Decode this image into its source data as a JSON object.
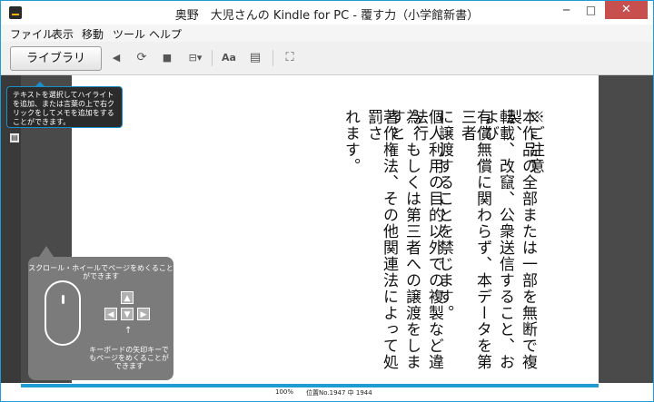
{
  "window": {
    "title": "奥野　大児さんの Kindle for PC - 覆す力（小学館新書）",
    "controls": {
      "minimize": "─",
      "maximize": "□",
      "close": "✕"
    }
  },
  "menu": [
    "ファイル",
    "表示",
    "移動",
    "ツール",
    "ヘルプ"
  ],
  "toolbar": {
    "library_label": "ライブラリ",
    "icons": [
      "back-arrow-icon",
      "sync-icon",
      "bookmark-icon",
      "goto-icon",
      "font-size-icon",
      "view-mode-icon",
      "fullscreen-icon"
    ],
    "glyphs": {
      "back": "◀",
      "sync": "⟳",
      "bookmark": "■",
      "goto": "⊟▾",
      "font": "Aa",
      "view": "▤",
      "fullscreen": "⛶"
    }
  },
  "page_text": {
    "columns": [
      "※ご注意",
      "本作品の全部または一部を無断で複製、",
      "転載、改竄、公衆送信すること、および",
      "有償無償に関わらず、本データを第三者",
      "に譲渡することを禁じます。",
      "個人利用の目的以外での複製など違法行",
      "為、もしくは第三者への譲渡をしますと",
      "著作権法、その他関連法によって処罰さ",
      "れます。"
    ]
  },
  "tooltips": {
    "highlight_tip": "テキストを選択してハイライトを追加、または言葉の上で右クリックをしてメモを追加をすることができます。",
    "scroll_tip": "スクロール・ホイールでページをめくることができます",
    "keyboard_tip": "キーボードの矢印キーでもページをめくることができます",
    "arrow_keys": {
      "up": "▲",
      "left": "◀",
      "down": "▼",
      "right": "▶"
    },
    "pointer_glyph": "↑"
  },
  "status": {
    "percent": "100%",
    "location": "位置No.1947 中 1944",
    "progress": 1.0
  },
  "colors": {
    "accent": "#1f9bd6",
    "close": "#c7504e"
  }
}
